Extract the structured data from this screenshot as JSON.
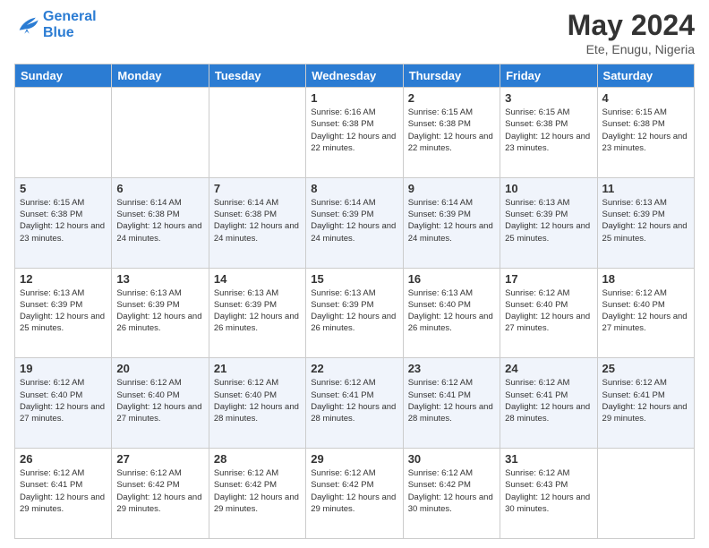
{
  "header": {
    "logo_line1": "General",
    "logo_line2": "Blue",
    "title": "May 2024",
    "subtitle": "Ete, Enugu, Nigeria"
  },
  "days_of_week": [
    "Sunday",
    "Monday",
    "Tuesday",
    "Wednesday",
    "Thursday",
    "Friday",
    "Saturday"
  ],
  "weeks": [
    [
      {
        "day": "",
        "info": ""
      },
      {
        "day": "",
        "info": ""
      },
      {
        "day": "",
        "info": ""
      },
      {
        "day": "1",
        "info": "Sunrise: 6:16 AM\nSunset: 6:38 PM\nDaylight: 12 hours\nand 22 minutes."
      },
      {
        "day": "2",
        "info": "Sunrise: 6:15 AM\nSunset: 6:38 PM\nDaylight: 12 hours\nand 22 minutes."
      },
      {
        "day": "3",
        "info": "Sunrise: 6:15 AM\nSunset: 6:38 PM\nDaylight: 12 hours\nand 23 minutes."
      },
      {
        "day": "4",
        "info": "Sunrise: 6:15 AM\nSunset: 6:38 PM\nDaylight: 12 hours\nand 23 minutes."
      }
    ],
    [
      {
        "day": "5",
        "info": "Sunrise: 6:15 AM\nSunset: 6:38 PM\nDaylight: 12 hours\nand 23 minutes."
      },
      {
        "day": "6",
        "info": "Sunrise: 6:14 AM\nSunset: 6:38 PM\nDaylight: 12 hours\nand 24 minutes."
      },
      {
        "day": "7",
        "info": "Sunrise: 6:14 AM\nSunset: 6:38 PM\nDaylight: 12 hours\nand 24 minutes."
      },
      {
        "day": "8",
        "info": "Sunrise: 6:14 AM\nSunset: 6:39 PM\nDaylight: 12 hours\nand 24 minutes."
      },
      {
        "day": "9",
        "info": "Sunrise: 6:14 AM\nSunset: 6:39 PM\nDaylight: 12 hours\nand 24 minutes."
      },
      {
        "day": "10",
        "info": "Sunrise: 6:13 AM\nSunset: 6:39 PM\nDaylight: 12 hours\nand 25 minutes."
      },
      {
        "day": "11",
        "info": "Sunrise: 6:13 AM\nSunset: 6:39 PM\nDaylight: 12 hours\nand 25 minutes."
      }
    ],
    [
      {
        "day": "12",
        "info": "Sunrise: 6:13 AM\nSunset: 6:39 PM\nDaylight: 12 hours\nand 25 minutes."
      },
      {
        "day": "13",
        "info": "Sunrise: 6:13 AM\nSunset: 6:39 PM\nDaylight: 12 hours\nand 26 minutes."
      },
      {
        "day": "14",
        "info": "Sunrise: 6:13 AM\nSunset: 6:39 PM\nDaylight: 12 hours\nand 26 minutes."
      },
      {
        "day": "15",
        "info": "Sunrise: 6:13 AM\nSunset: 6:39 PM\nDaylight: 12 hours\nand 26 minutes."
      },
      {
        "day": "16",
        "info": "Sunrise: 6:13 AM\nSunset: 6:40 PM\nDaylight: 12 hours\nand 26 minutes."
      },
      {
        "day": "17",
        "info": "Sunrise: 6:12 AM\nSunset: 6:40 PM\nDaylight: 12 hours\nand 27 minutes."
      },
      {
        "day": "18",
        "info": "Sunrise: 6:12 AM\nSunset: 6:40 PM\nDaylight: 12 hours\nand 27 minutes."
      }
    ],
    [
      {
        "day": "19",
        "info": "Sunrise: 6:12 AM\nSunset: 6:40 PM\nDaylight: 12 hours\nand 27 minutes."
      },
      {
        "day": "20",
        "info": "Sunrise: 6:12 AM\nSunset: 6:40 PM\nDaylight: 12 hours\nand 27 minutes."
      },
      {
        "day": "21",
        "info": "Sunrise: 6:12 AM\nSunset: 6:40 PM\nDaylight: 12 hours\nand 28 minutes."
      },
      {
        "day": "22",
        "info": "Sunrise: 6:12 AM\nSunset: 6:41 PM\nDaylight: 12 hours\nand 28 minutes."
      },
      {
        "day": "23",
        "info": "Sunrise: 6:12 AM\nSunset: 6:41 PM\nDaylight: 12 hours\nand 28 minutes."
      },
      {
        "day": "24",
        "info": "Sunrise: 6:12 AM\nSunset: 6:41 PM\nDaylight: 12 hours\nand 28 minutes."
      },
      {
        "day": "25",
        "info": "Sunrise: 6:12 AM\nSunset: 6:41 PM\nDaylight: 12 hours\nand 29 minutes."
      }
    ],
    [
      {
        "day": "26",
        "info": "Sunrise: 6:12 AM\nSunset: 6:41 PM\nDaylight: 12 hours\nand 29 minutes."
      },
      {
        "day": "27",
        "info": "Sunrise: 6:12 AM\nSunset: 6:42 PM\nDaylight: 12 hours\nand 29 minutes."
      },
      {
        "day": "28",
        "info": "Sunrise: 6:12 AM\nSunset: 6:42 PM\nDaylight: 12 hours\nand 29 minutes."
      },
      {
        "day": "29",
        "info": "Sunrise: 6:12 AM\nSunset: 6:42 PM\nDaylight: 12 hours\nand 29 minutes."
      },
      {
        "day": "30",
        "info": "Sunrise: 6:12 AM\nSunset: 6:42 PM\nDaylight: 12 hours\nand 30 minutes."
      },
      {
        "day": "31",
        "info": "Sunrise: 6:12 AM\nSunset: 6:43 PM\nDaylight: 12 hours\nand 30 minutes."
      },
      {
        "day": "",
        "info": ""
      }
    ]
  ]
}
